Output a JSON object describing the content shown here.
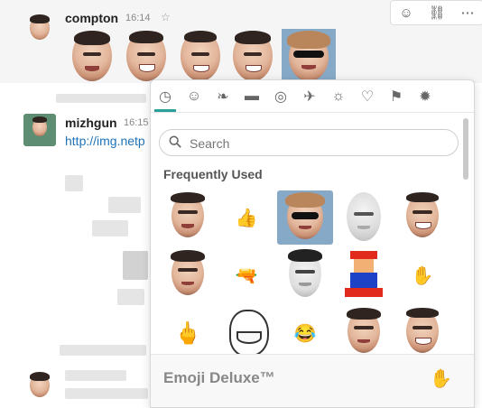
{
  "messages": [
    {
      "username": "compton",
      "time": "16:14",
      "star_icon": "star-icon"
    },
    {
      "username": "mizhgun",
      "time": "16:15",
      "link": "http://img.netp"
    }
  ],
  "actions": [
    {
      "icon": "add-reaction-icon",
      "glyph": "☺+"
    },
    {
      "icon": "link-icon",
      "glyph": "⛓"
    },
    {
      "icon": "more-icon",
      "glyph": "⋯"
    }
  ],
  "picker": {
    "tabs": [
      {
        "icon": "clock-icon",
        "glyph": "◷",
        "active": true
      },
      {
        "icon": "smiley-icon",
        "glyph": "☺"
      },
      {
        "icon": "leaf-icon",
        "glyph": "❧"
      },
      {
        "icon": "burger-icon",
        "glyph": "▬"
      },
      {
        "icon": "football-icon",
        "glyph": "◎"
      },
      {
        "icon": "airplane-icon",
        "glyph": "✈"
      },
      {
        "icon": "lightbulb-icon",
        "glyph": "☼"
      },
      {
        "icon": "heart-icon",
        "glyph": "♡"
      },
      {
        "icon": "flag-icon",
        "glyph": "⚑"
      },
      {
        "icon": "custom-icon",
        "glyph": "✹"
      }
    ],
    "search_placeholder": "Search",
    "section_title": "Frequently Used",
    "emoji": [
      {
        "kind": "face"
      },
      {
        "kind": "glyph",
        "glyph": "👍"
      },
      {
        "kind": "face-sunglasses",
        "selected": true
      },
      {
        "kind": "face-bald"
      },
      {
        "kind": "face-smile"
      },
      {
        "kind": "face"
      },
      {
        "kind": "glyph",
        "glyph": "🔫"
      },
      {
        "kind": "face"
      },
      {
        "kind": "glyph",
        "glyph": "🕹"
      },
      {
        "kind": "glyph",
        "glyph": "✋"
      },
      {
        "kind": "glyph",
        "glyph": "🖕"
      },
      {
        "kind": "face-troll"
      },
      {
        "kind": "glyph",
        "glyph": "😂"
      },
      {
        "kind": "face"
      },
      {
        "kind": "face-smile"
      }
    ],
    "footer_name": "Emoji Deluxe™",
    "footer_glyph": "✋"
  }
}
